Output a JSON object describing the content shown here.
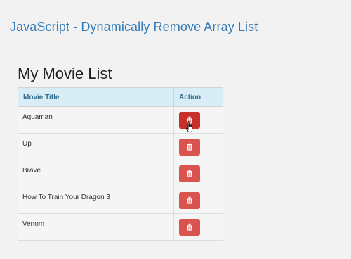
{
  "header": {
    "title": "JavaScript - Dynamically Remove Array List"
  },
  "list": {
    "heading": "My Movie List",
    "columns": [
      "Movie Title",
      "Action"
    ],
    "movies": [
      "Aquaman",
      "Up",
      "Brave",
      "How To Train Your Dragon 3",
      "Venom"
    ],
    "delete_icon": "trash-icon",
    "colors": {
      "header_bg": "#d9edf7",
      "header_text": "#31708f",
      "button": "#d9534f",
      "button_hover": "#c9302c",
      "title": "#337ab7"
    }
  }
}
